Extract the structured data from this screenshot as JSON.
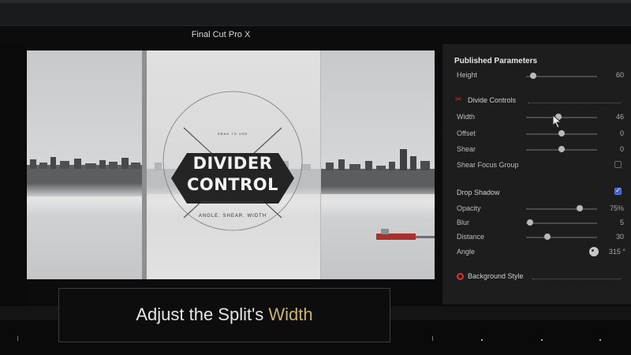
{
  "window": {
    "title": "Final Cut Pro X"
  },
  "viewer": {
    "badge": {
      "small_text": "DRAG TO USE",
      "title_line1": "DIVIDER",
      "title_line2": "CONTROL",
      "subtitle": "ANGLE. SHEAR. WIDTH"
    }
  },
  "caption": {
    "prefix": "Adjust the Split's ",
    "highlight": "Width"
  },
  "inspector": {
    "title": "Published Parameters",
    "height": {
      "label": "Height",
      "value": "60",
      "level": 0.1
    },
    "divide_controls": {
      "label": "Divide Controls",
      "icon": "scissors-icon",
      "params": [
        {
          "label": "Width",
          "value": "46",
          "level": 0.46
        },
        {
          "label": "Offset",
          "value": "0",
          "level": 0.5
        },
        {
          "label": "Shear",
          "value": "0",
          "level": 0.5
        }
      ],
      "focus_group": {
        "label": "Shear Focus Group",
        "checked": false
      }
    },
    "drop_shadow": {
      "label": "Drop Shadow",
      "checked": true,
      "params": [
        {
          "label": "Opacity",
          "value": "75%",
          "level": 0.75
        },
        {
          "label": "Blur",
          "value": "5",
          "level": 0.05
        },
        {
          "label": "Distance",
          "value": "30",
          "level": 0.3
        }
      ],
      "angle": {
        "label": "Angle",
        "value": "315 °"
      }
    },
    "background_style": {
      "label": "Background Style",
      "icon": "ring-icon"
    }
  },
  "colors": {
    "accent_highlight": "#c9b26a",
    "checkbox_on": "#3b5bdb",
    "section_icon": "#e03131"
  }
}
